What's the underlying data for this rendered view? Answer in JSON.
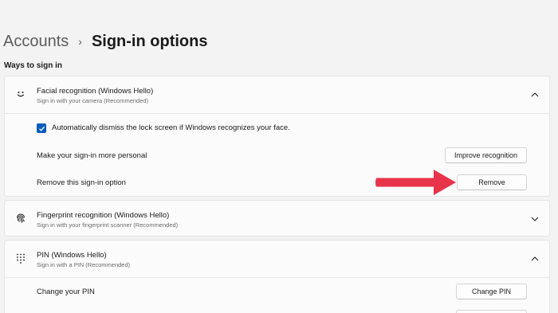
{
  "breadcrumb": {
    "parent": "Accounts",
    "separator": "›",
    "current": "Sign-in options"
  },
  "section": {
    "title": "Ways to sign in"
  },
  "facial": {
    "icon": "smiley-face-icon",
    "title": "Facial recognition (Windows Hello)",
    "subtitle": "Sign in with your camera (Recommended)",
    "expanded": true,
    "checkbox_label": "Automatically dismiss the lock screen if Windows recognizes your face.",
    "checkbox_checked": true,
    "personal_label": "Make your sign-in more personal",
    "improve_button": "Improve recognition",
    "remove_label": "Remove this sign-in option",
    "remove_button": "Remove"
  },
  "fingerprint": {
    "icon": "fingerprint-icon",
    "title": "Fingerprint recognition (Windows Hello)",
    "subtitle": "Sign in with your fingerprint scanner (Recommended)",
    "expanded": false
  },
  "pin": {
    "icon": "keypad-icon",
    "title": "PIN (Windows Hello)",
    "subtitle": "Sign in with a PIN (Recommended)",
    "expanded": true,
    "change_label": "Change your PIN",
    "change_button": "Change PIN"
  },
  "annotation": {
    "arrow_color": "#e8344a",
    "accent_color": "#0a5cb8"
  }
}
